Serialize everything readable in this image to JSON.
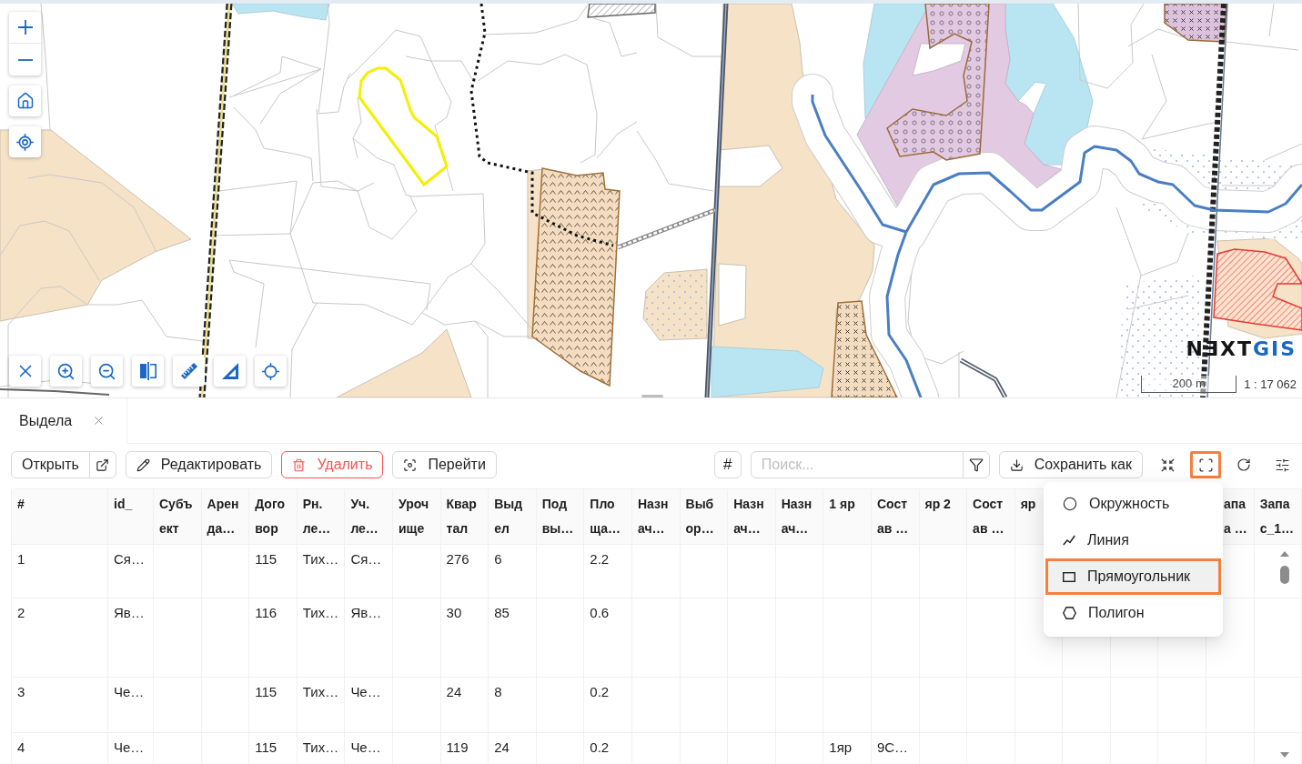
{
  "map": {
    "logo": {
      "main": "NƎXT",
      "accent": "GIS"
    },
    "scale": {
      "distance": "200 m",
      "ratio": "1 : 17 062"
    }
  },
  "tabs": [
    {
      "label": "Выдела",
      "selected": true
    }
  ],
  "actions": [
    {
      "kind": "open",
      "label": "Открыть"
    },
    {
      "kind": "edit",
      "label": "Редактировать"
    },
    {
      "kind": "delete",
      "label": "Удалить"
    },
    {
      "kind": "goto",
      "label": "Перейти"
    }
  ],
  "numbering_toggle": {
    "label": "#"
  },
  "search": {
    "placeholder": "Поиск..."
  },
  "save_as": {
    "label": "Сохранить как"
  },
  "tools": [
    {
      "kind": "collapse",
      "selected": false
    },
    {
      "kind": "frame",
      "selected": true
    },
    {
      "kind": "refresh",
      "selected": false
    },
    {
      "kind": "settings",
      "selected": false
    }
  ],
  "draw_menu": [
    {
      "kind": "circle",
      "label": "Окружность",
      "selected": false
    },
    {
      "kind": "line",
      "label": "Линия",
      "selected": false
    },
    {
      "kind": "rectangle",
      "label": "Прямоугольник",
      "selected": true
    },
    {
      "kind": "polygon",
      "label": "Полигон",
      "selected": false
    }
  ],
  "table": {
    "columns": [
      "#",
      "id_",
      "Субъект",
      "Аренда…",
      "Договор",
      "Рн. ле…",
      "Уч. ле…",
      "Урочище",
      "Квартал",
      "Выдел",
      "Под вы…",
      "Площа…",
      "Назнач…",
      "Выбор…",
      "Назнач…",
      "Назнач…",
      "1 яр",
      "Состав …",
      "яр 2",
      "Состав …",
      "яр",
      null,
      null,
      null,
      "апа а …",
      "Запас_1…"
    ],
    "rows": [
      [
        "1",
        "Ся…",
        null,
        null,
        "115",
        "Тих…",
        "Ся…",
        null,
        "276",
        "6",
        null,
        "2.2"
      ],
      [
        "2",
        "Яв…",
        null,
        null,
        "116",
        "Тих…",
        "Яв…",
        null,
        "30",
        "85",
        null,
        "0.6"
      ],
      [
        "3",
        "Че…",
        null,
        null,
        "115",
        "Тих…",
        "Че…",
        null,
        "24",
        "8",
        null,
        "0.2"
      ],
      [
        "4",
        "Че…",
        null,
        null,
        "115",
        "Тих…",
        "Че…",
        null,
        "119",
        "24",
        null,
        "0.2",
        null,
        null,
        null,
        null,
        "1яр",
        "9С…"
      ]
    ]
  }
}
